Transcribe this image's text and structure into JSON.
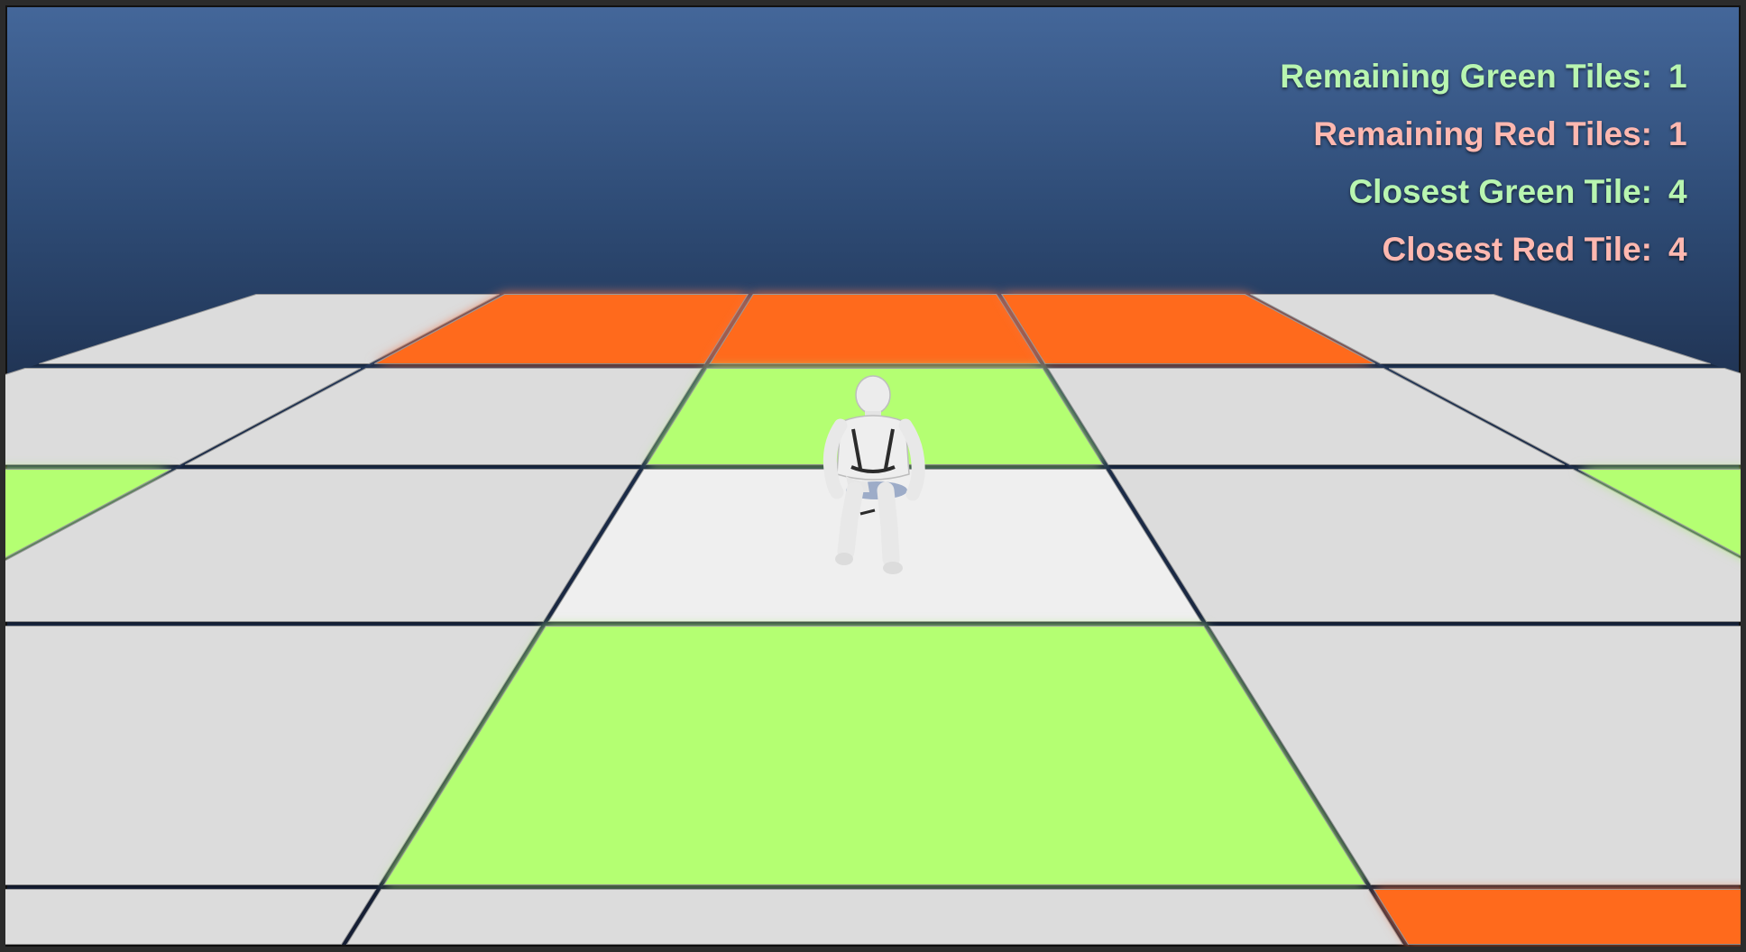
{
  "hud": {
    "rows": [
      {
        "label": "Remaining Green Tiles:",
        "value": "1",
        "color": "#b8f5b0"
      },
      {
        "label": "Remaining Red Tiles:",
        "value": "1",
        "color": "#ffb8b0"
      },
      {
        "label": "Closest Green Tile:",
        "value": "4",
        "color": "#b8f5b0"
      },
      {
        "label": "Closest Red Tile:",
        "value": "4",
        "color": "#ffb8b0"
      }
    ]
  },
  "board": {
    "rows_top_to_bottom": [
      [
        "white",
        "red",
        "red",
        "red",
        "white"
      ],
      [
        "white",
        "white",
        "green",
        "white",
        "white"
      ],
      [
        "green",
        "white",
        "white",
        "white",
        "green"
      ],
      [
        "white",
        "white",
        "green",
        "white",
        "white"
      ],
      [
        "white",
        "white",
        "white",
        "red",
        "white"
      ]
    ],
    "player_tile": {
      "row": 2,
      "col": 2
    }
  },
  "colors": {
    "white": "#dcdcdc",
    "player_tile": "#efefef",
    "green": "#b4ff72",
    "red": "#ff6a1e"
  }
}
